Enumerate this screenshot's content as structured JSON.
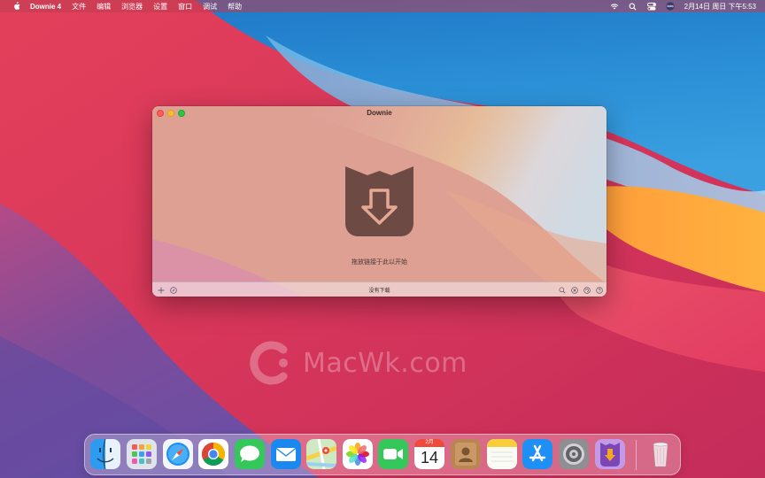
{
  "menubar": {
    "app_name": "Downie 4",
    "items": [
      "文件",
      "编辑",
      "浏览器",
      "设置",
      "窗口",
      "调试",
      "帮助"
    ],
    "datetime": "2月14日 周日 下午5:53",
    "status_icons": [
      "wifi-icon",
      "spotlight-icon",
      "control-center-icon",
      "siri-icon"
    ]
  },
  "window": {
    "title": "Downie",
    "drop_hint": "拖放链接于此以开始",
    "status": "没有下载",
    "bottom_left_buttons": [
      "add-icon",
      "compass-icon"
    ],
    "bottom_right_buttons": [
      "search-icon",
      "cancel-icon",
      "refresh-icon",
      "help-icon"
    ]
  },
  "watermark": {
    "text": "MacWk.com"
  },
  "dock": {
    "apps": [
      "Finder",
      "Launchpad",
      "Safari",
      "Chrome",
      "Messages",
      "Mail",
      "Maps",
      "Photos",
      "FaceTime",
      "Calendar",
      "Contacts",
      "Notes",
      "App Store",
      "System Preferences",
      "Downie"
    ],
    "calendar": {
      "month": "2月",
      "day": "14"
    },
    "trash": "Trash"
  },
  "colors": {
    "close": "#ff5f57",
    "minimize": "#febc2e",
    "zoom": "#28c840",
    "logo": "#6e4a45"
  }
}
